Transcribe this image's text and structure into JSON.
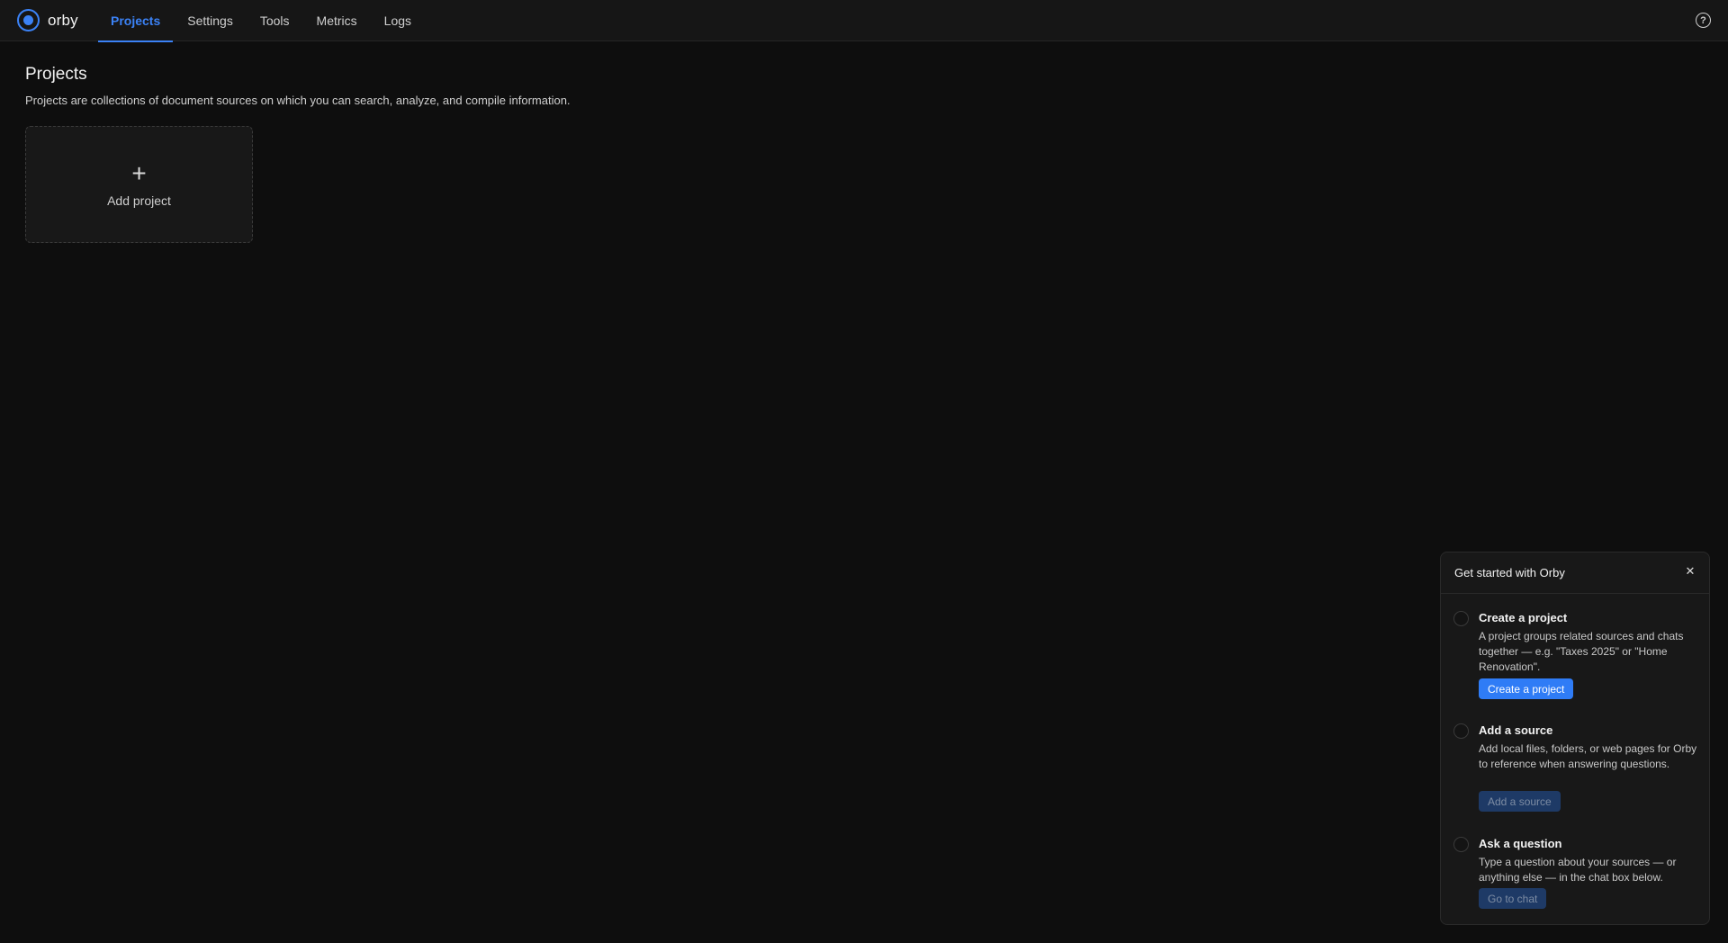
{
  "app": {
    "name": "orby"
  },
  "nav": {
    "tabs": [
      {
        "label": "Projects",
        "active": true
      },
      {
        "label": "Settings",
        "active": false
      },
      {
        "label": "Tools",
        "active": false
      },
      {
        "label": "Metrics",
        "active": false
      },
      {
        "label": "Logs",
        "active": false
      }
    ],
    "help_icon": "question-circle-icon",
    "help_glyph": "?"
  },
  "main": {
    "title": "Projects",
    "description": "Projects are collections of document sources on which you can search, analyze, and compile information.",
    "add_card": {
      "icon": "plus-icon",
      "glyph": "+",
      "label": "Add project"
    }
  },
  "onboarding": {
    "title": "Get started with Orby",
    "close_glyph": "✕",
    "steps": [
      {
        "title": "Create a project",
        "description": "A project groups related sources and chats together — e.g. \"Taxes 2025\" or \"Home Renovation\".",
        "button": "Create a project",
        "button_enabled": true
      },
      {
        "title": "Add a source",
        "description": "Add local files, folders, or web pages for Orby to reference when answering questions.",
        "button": "Add a source",
        "button_enabled": false
      },
      {
        "title": "Ask a question",
        "description": "Type a question about your sources — or anything else — in the chat box below.",
        "button": "Go to chat",
        "button_enabled": false
      }
    ]
  },
  "colors": {
    "accent": "#3b82f6",
    "background": "#0e0e0e",
    "panel": "#181818",
    "primary_button": "#2f7cf6",
    "disabled_button": "#1e3a66"
  }
}
